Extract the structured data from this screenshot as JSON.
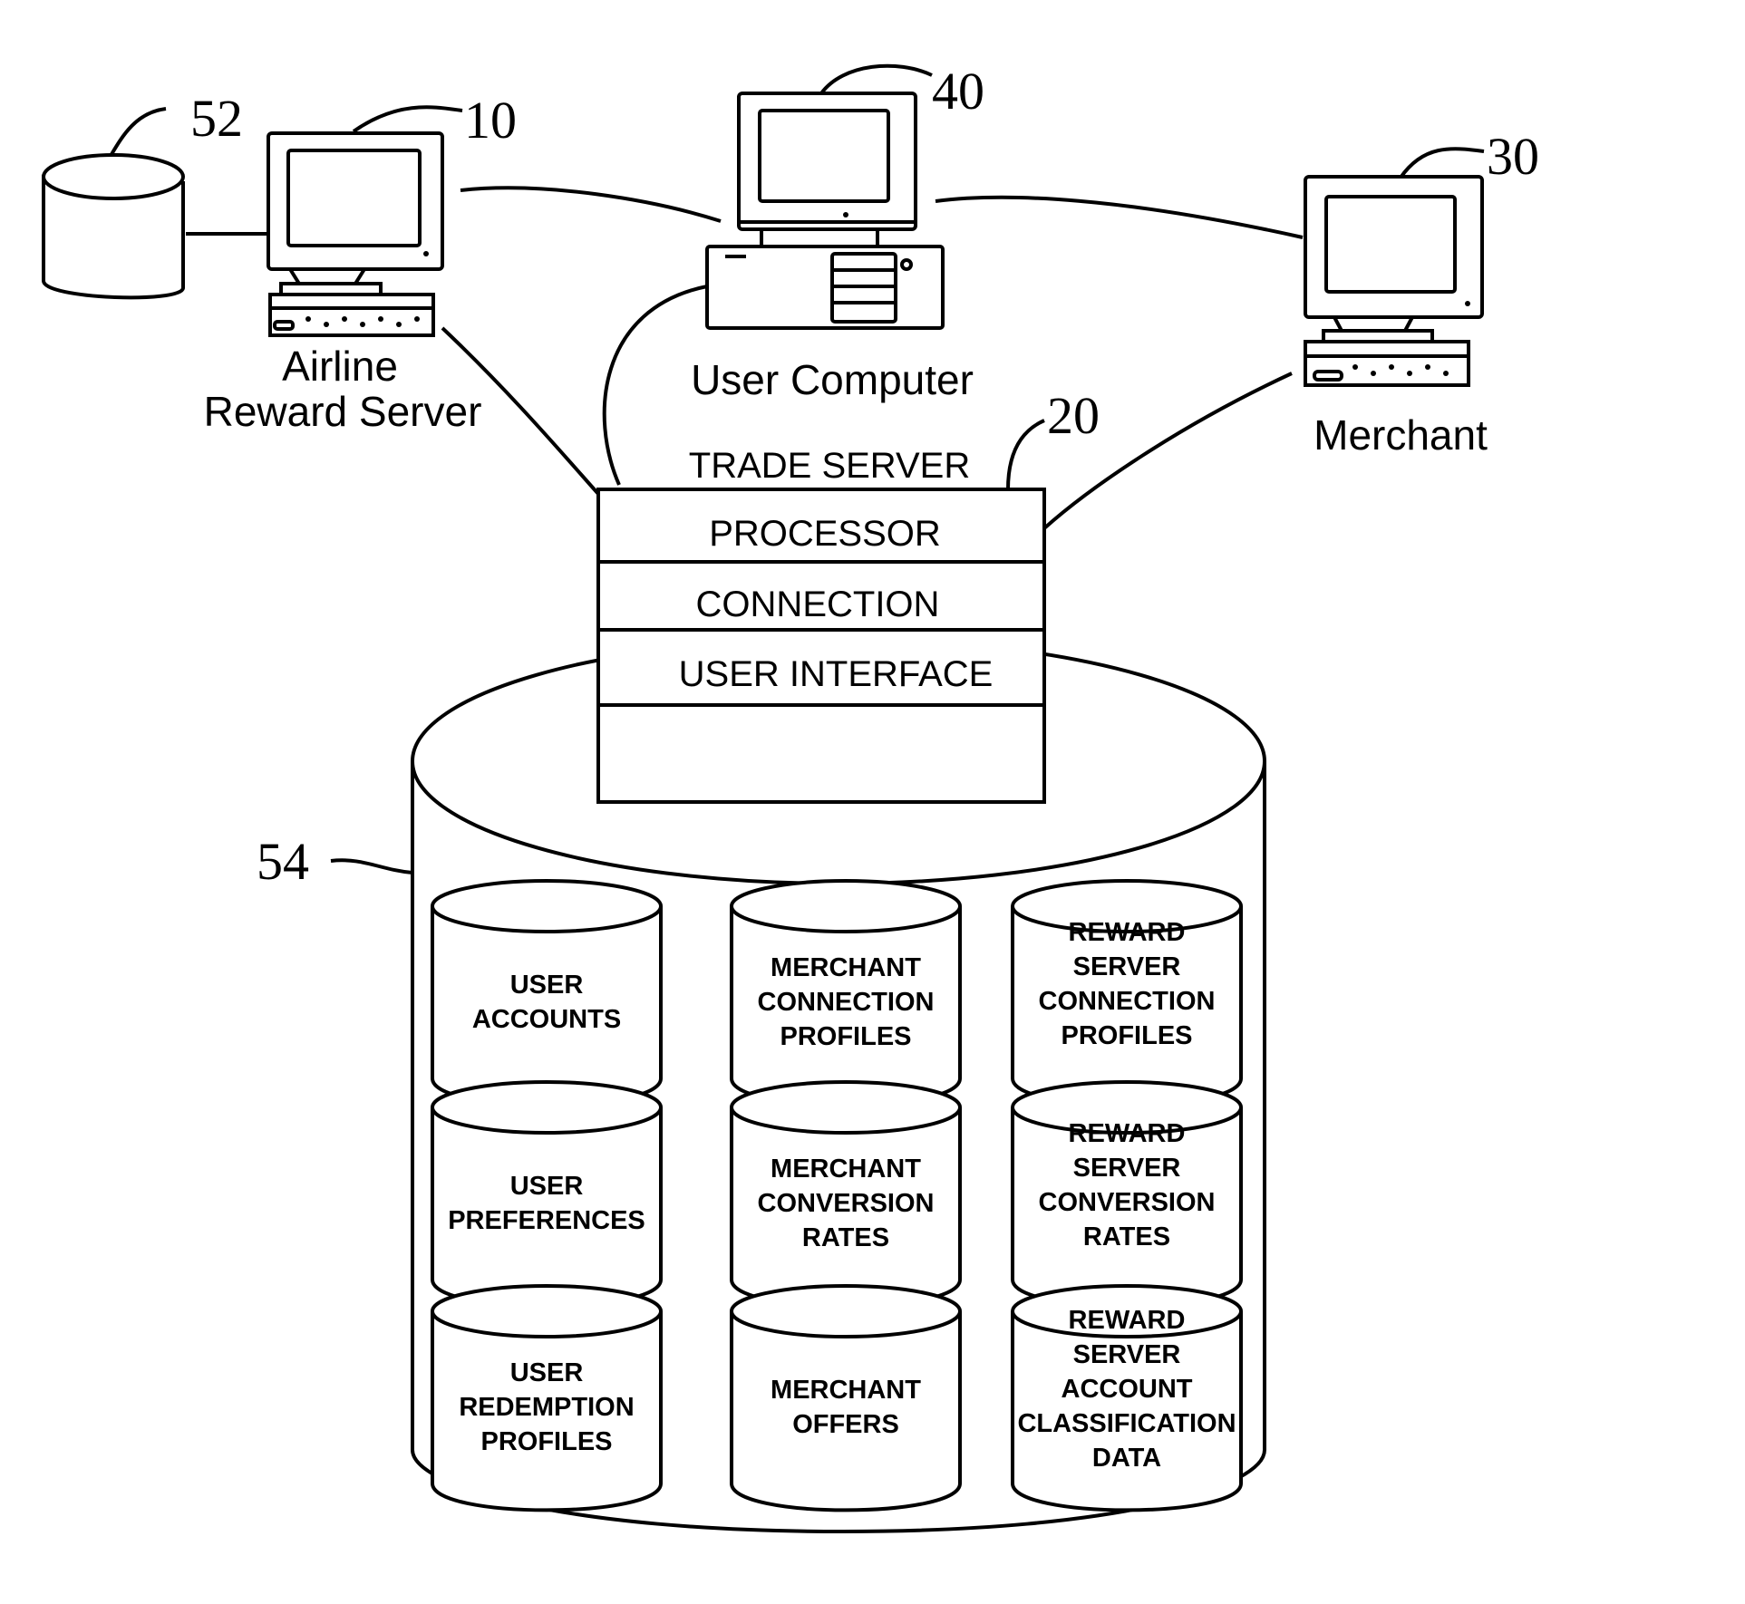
{
  "figure": {
    "nodes": {
      "airline_reward_server": {
        "ref": "10",
        "label_line1": "Airline",
        "label_line2": "Reward Server"
      },
      "reward_db": {
        "ref": "52"
      },
      "user_computer": {
        "ref": "40",
        "label": "User Computer"
      },
      "merchant": {
        "ref": "30",
        "label": "Merchant"
      },
      "trade_server": {
        "ref": "20",
        "label": "TRADE SERVER",
        "sections": [
          "PROCESSOR",
          "CONNECTION",
          "USER INTERFACE",
          ""
        ]
      },
      "database": {
        "ref": "54",
        "stores": [
          [
            "USER",
            "ACCOUNTS"
          ],
          [
            "MERCHANT",
            "CONNECTION",
            "PROFILES"
          ],
          [
            "REWARD",
            "SERVER",
            "CONNECTION",
            "PROFILES"
          ],
          [
            "USER",
            "PREFERENCES"
          ],
          [
            "MERCHANT",
            "CONVERSION",
            "RATES"
          ],
          [
            "REWARD",
            "SERVER",
            "CONVERSION",
            "RATES"
          ],
          [
            "USER",
            "REDEMPTION",
            "PROFILES"
          ],
          [
            "MERCHANT",
            "OFFERS"
          ],
          [
            "REWARD",
            "SERVER",
            "ACCOUNT",
            "CLASSIFICATION",
            "DATA"
          ]
        ]
      }
    }
  }
}
